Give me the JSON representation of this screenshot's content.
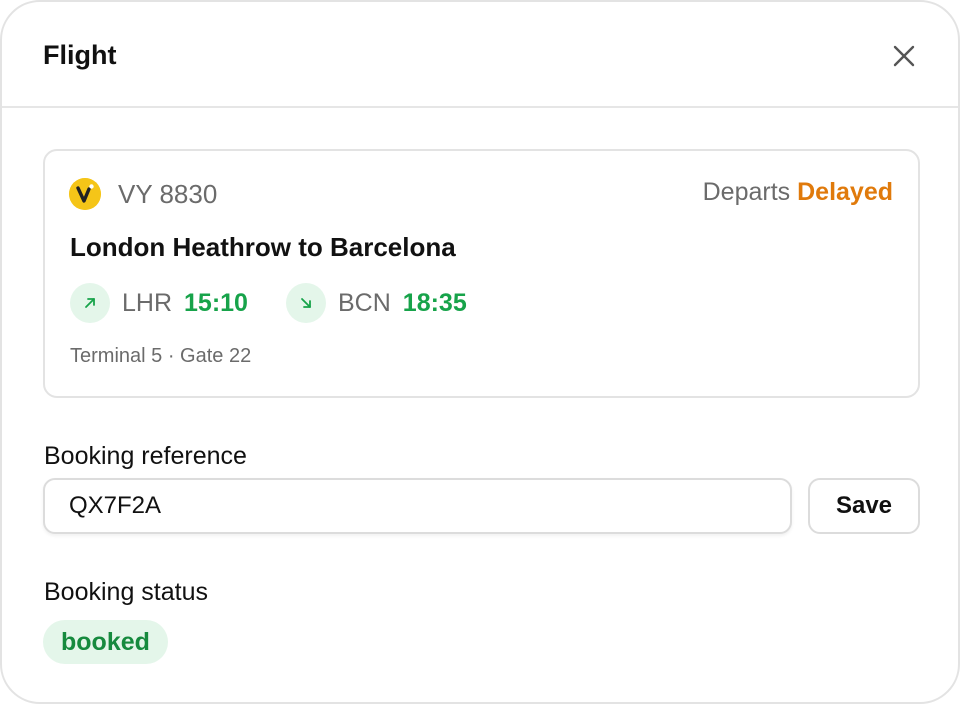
{
  "dialog": {
    "title": "Flight",
    "close_icon": "close-icon"
  },
  "flight": {
    "airline_logo": "airline-logo-icon",
    "number": "VY 8830",
    "departs_label": "Departs",
    "departure_status": "Delayed",
    "route": "London Heathrow to Barcelona",
    "departure": {
      "icon": "arrow-up-right-icon",
      "airport": "LHR",
      "time": "15:10"
    },
    "arrival": {
      "icon": "arrow-down-right-icon",
      "airport": "BCN",
      "time": "18:35"
    },
    "terminal_gate": "Terminal 5 · Gate 22"
  },
  "booking": {
    "reference_label": "Booking reference",
    "reference_value": "QX7F2A",
    "save_label": "Save",
    "status_label": "Booking status",
    "status_value": "booked"
  },
  "colors": {
    "accent_green": "#17a34a",
    "delayed_orange": "#e07a0b",
    "badge_bg": "#e4f6ea",
    "logo_yellow": "#f5c518"
  }
}
